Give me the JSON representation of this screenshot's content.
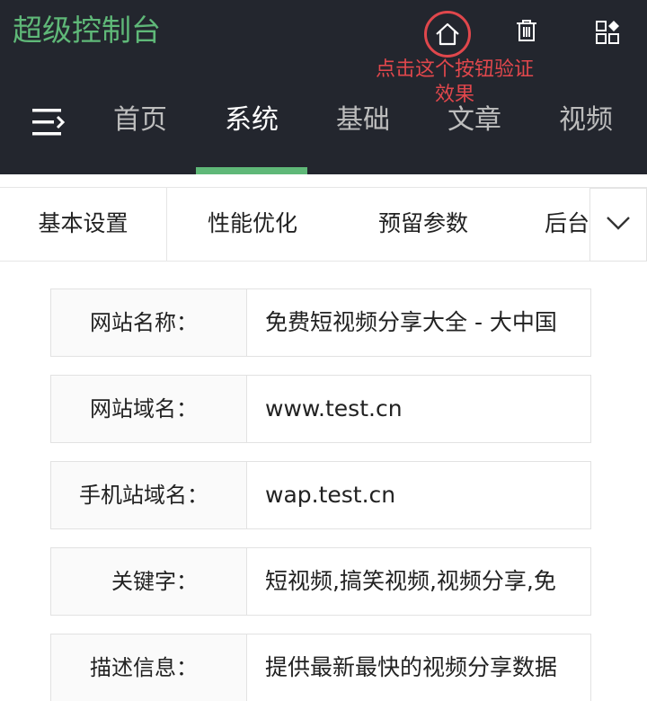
{
  "colors": {
    "header_bg": "#23262e",
    "accent_green": "#5fb878",
    "hint_red": "#e0474c",
    "nav_active": "#ffffff",
    "nav_inactive": "#bdbdbd",
    "text_dark": "#222222"
  },
  "header": {
    "app_title": "超级控制台",
    "actions": [
      {
        "name": "home",
        "icon": "home-icon"
      },
      {
        "name": "clear-cache",
        "icon": "trash-icon"
      },
      {
        "name": "theme",
        "icon": "grid-icon"
      }
    ],
    "hint": "点击这个按钮验证效果"
  },
  "nav": {
    "toggle_icon": "menu-collapse-icon",
    "items": [
      {
        "label": "首页",
        "active": false
      },
      {
        "label": "系统",
        "active": true
      },
      {
        "label": "基础",
        "active": false
      },
      {
        "label": "文章",
        "active": false
      },
      {
        "label": "视频",
        "active": false
      }
    ]
  },
  "subtabs": {
    "items": [
      "基本设置",
      "性能优化",
      "预留参数",
      "后台"
    ],
    "active_index": 0,
    "more_icon": "chevron-down-icon"
  },
  "form": {
    "fields": [
      {
        "label": "网站名称：",
        "value": "免费短视频分享大全 - 大中国"
      },
      {
        "label": "网站域名：",
        "value": "www.test.cn"
      },
      {
        "label": "手机站域名：",
        "value": "wap.test.cn"
      },
      {
        "label": "关键字：",
        "value": "短视频,搞笑视频,视频分享,免"
      },
      {
        "label": "描述信息：",
        "value": "提供最新最快的视频分享数据"
      }
    ]
  }
}
